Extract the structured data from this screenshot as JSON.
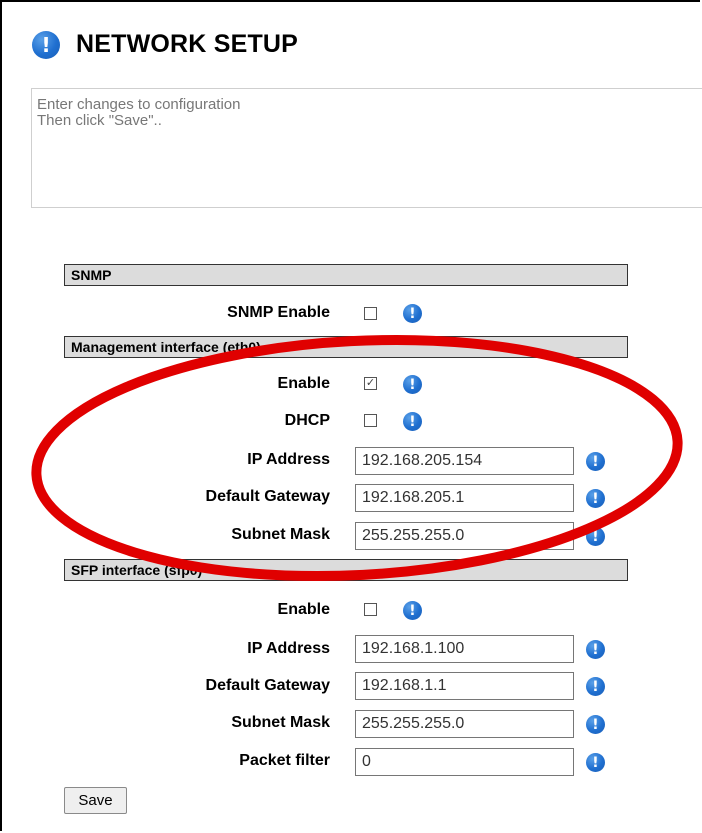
{
  "page": {
    "title": "NETWORK SETUP",
    "title_icon": "info-icon",
    "message": "Enter changes to configuration\nThen click \"Save\".."
  },
  "sections": {
    "snmp": {
      "header": "SNMP",
      "snmp_enable": {
        "label": "SNMP Enable",
        "checked": false
      }
    },
    "management": {
      "header": "Management interface (eth0)",
      "enable": {
        "label": "Enable",
        "checked": true
      },
      "dhcp": {
        "label": "DHCP",
        "checked": false
      },
      "ip_address": {
        "label": "IP Address",
        "value": "192.168.205.154"
      },
      "default_gateway": {
        "label": "Default Gateway",
        "value": "192.168.205.1"
      },
      "subnet_mask": {
        "label": "Subnet Mask",
        "value": "255.255.255.0"
      }
    },
    "sfp": {
      "header": "SFP interface (sfp0)",
      "enable": {
        "label": "Enable",
        "checked": false
      },
      "ip_address": {
        "label": "IP Address",
        "value": "192.168.1.100"
      },
      "default_gateway": {
        "label": "Default Gateway",
        "value": "192.168.1.1"
      },
      "subnet_mask": {
        "label": "Subnet Mask",
        "value": "255.255.255.0"
      },
      "packet_filter": {
        "label": "Packet filter",
        "value": "0"
      }
    }
  },
  "actions": {
    "save_label": "Save"
  },
  "icons": {
    "help": "info-icon",
    "help_glyph": "!"
  },
  "colors": {
    "help_icon": "#1f6fd0",
    "annotation": "#e00000",
    "section_header_bg": "#dcdcdc"
  },
  "annotation": {
    "shape": "ellipse",
    "target": "management-interface-fields"
  }
}
